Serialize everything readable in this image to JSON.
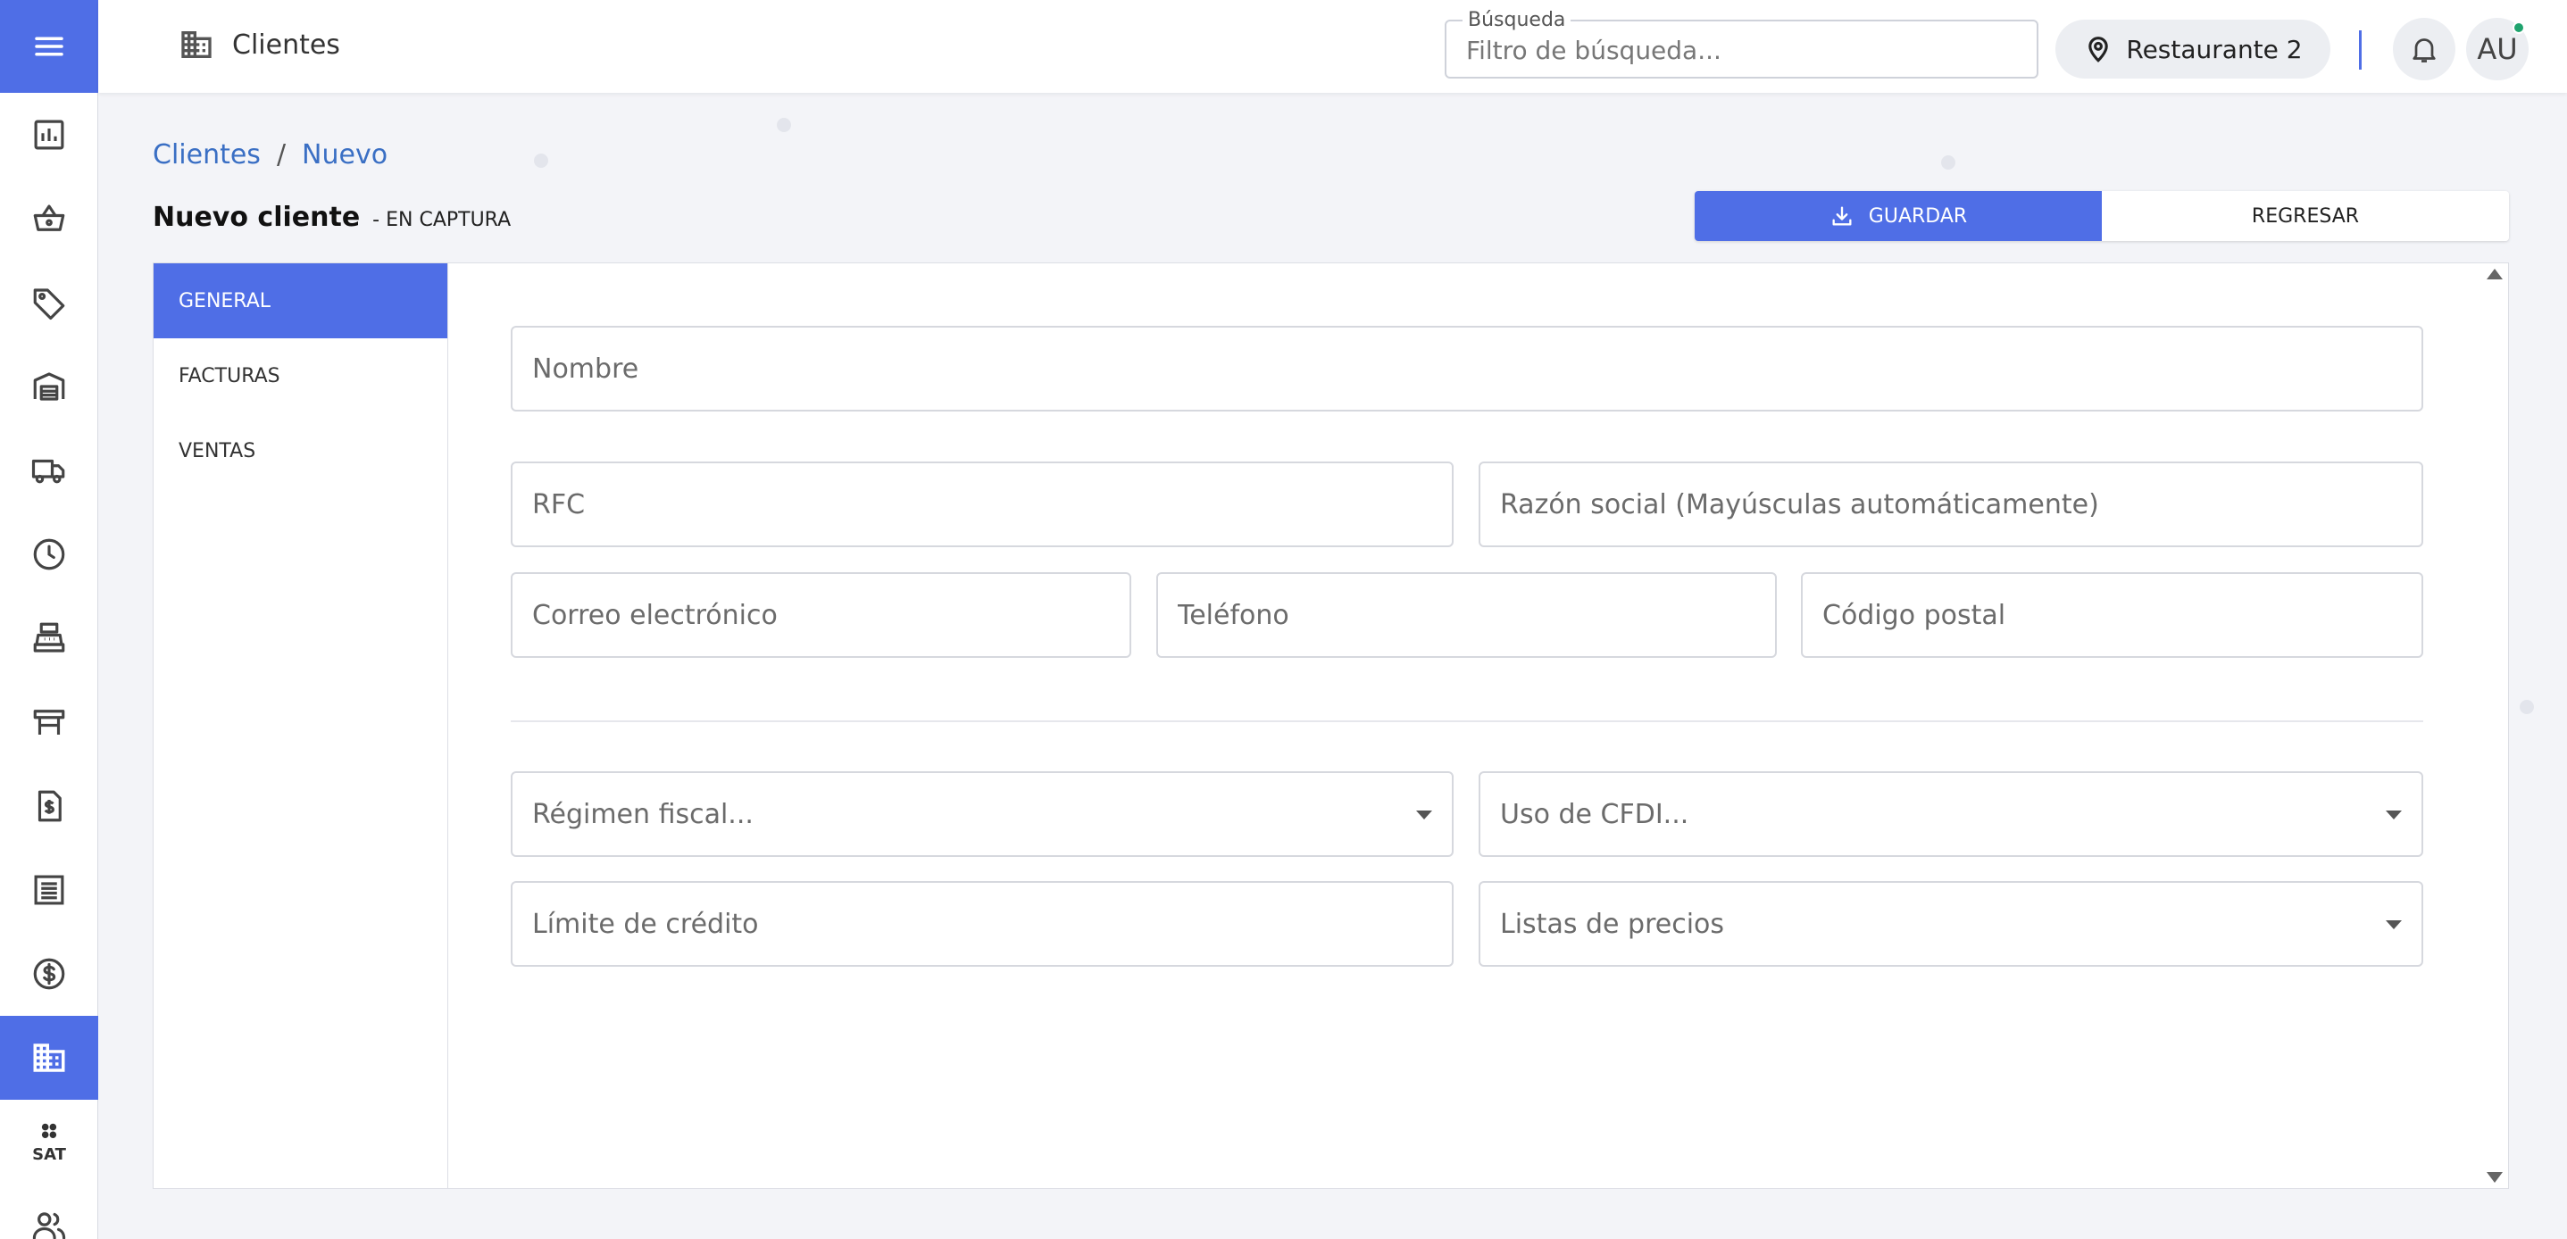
{
  "topbar": {
    "module_title": "Clientes",
    "search_legend": "Búsqueda",
    "search_placeholder": "Filtro de búsqueda...",
    "location": "Restaurante 2",
    "avatar_initials": "AU"
  },
  "sidebar": {
    "items": [
      {
        "icon": "bar-chart-icon",
        "active": false
      },
      {
        "icon": "basket-icon",
        "active": false
      },
      {
        "icon": "tag-icon",
        "active": false
      },
      {
        "icon": "warehouse-icon",
        "active": false
      },
      {
        "icon": "truck-icon",
        "active": false
      },
      {
        "icon": "clock-icon",
        "active": false
      },
      {
        "icon": "cash-register-icon",
        "active": false
      },
      {
        "icon": "table-icon",
        "active": false
      },
      {
        "icon": "invoice-icon",
        "active": false
      },
      {
        "icon": "list-icon",
        "active": false
      },
      {
        "icon": "dollar-icon",
        "active": false
      },
      {
        "icon": "building-icon",
        "active": true
      },
      {
        "icon": "sat-icon",
        "active": false,
        "label": "SAT"
      },
      {
        "icon": "users-icon",
        "active": false
      }
    ]
  },
  "breadcrumb": {
    "root": "Clientes",
    "separator": "/",
    "current": "Nuevo"
  },
  "header": {
    "title": "Nuevo cliente",
    "status": "- EN CAPTURA",
    "save_label": "GUARDAR",
    "back_label": "REGRESAR"
  },
  "tabs": [
    {
      "label": "GENERAL",
      "active": true
    },
    {
      "label": "FACTURAS",
      "active": false
    },
    {
      "label": "VENTAS",
      "active": false
    }
  ],
  "form": {
    "nombre": "Nombre",
    "rfc": "RFC",
    "razon_social": "Razón social (Mayúsculas automáticamente)",
    "correo": "Correo electrónico",
    "telefono": "Teléfono",
    "codigo_postal": "Código postal",
    "regimen_fiscal": "Régimen fiscal...",
    "uso_cfdi": "Uso de CFDI...",
    "limite_credito": "Límite de crédito",
    "listas_precios": "Listas de precios"
  },
  "colors": {
    "accent": "#4f6ee6",
    "link": "#3a6fc4",
    "online_dot": "#1fa36e"
  }
}
